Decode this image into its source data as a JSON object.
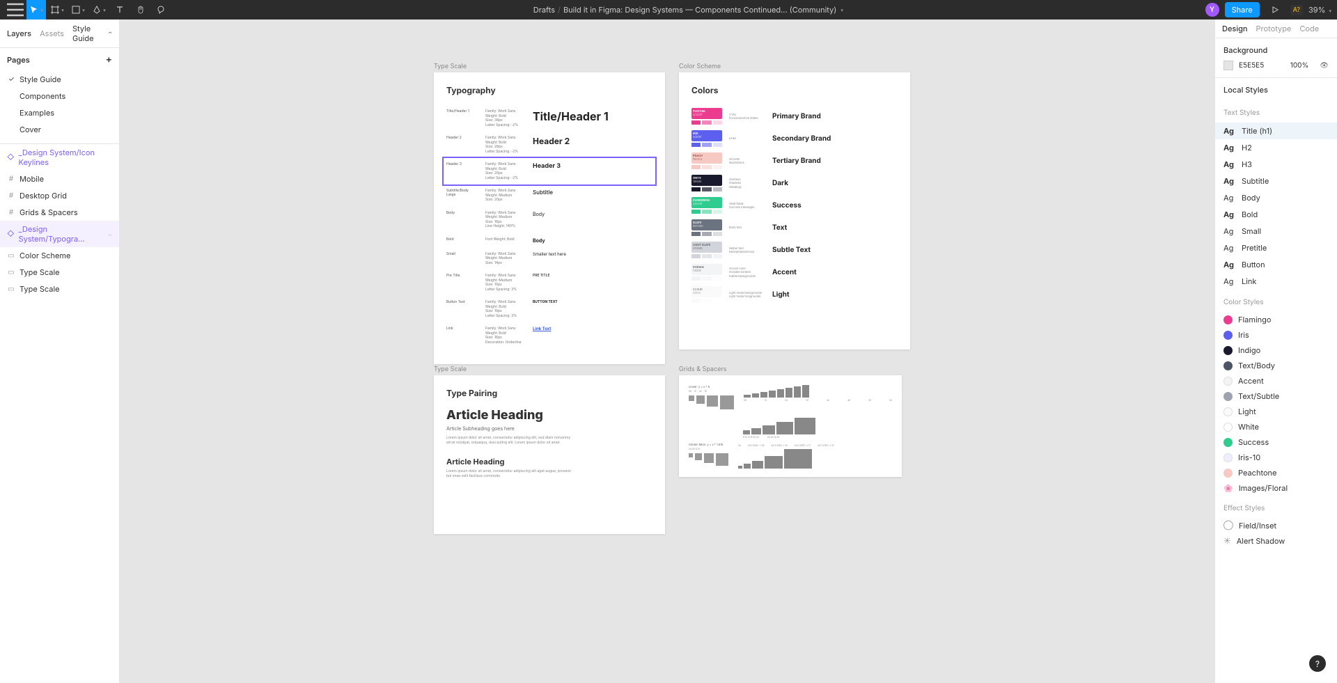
{
  "topbar": {
    "breadcrumb_root": "Drafts",
    "breadcrumb_file": "Build it in Figma: Design Systems — Components Continued... (Community)",
    "share_label": "Share",
    "a7_label": "A?",
    "zoom": "39%",
    "avatar_letter": "Y"
  },
  "left_panel": {
    "tab_layers": "Layers",
    "tab_assets": "Assets",
    "style_guide": "Style Guide",
    "pages_label": "Pages",
    "pages": [
      "Style Guide",
      "Components",
      "Examples",
      "Cover"
    ],
    "layers": [
      {
        "name": "_Design System/Icon Keylines",
        "icon": "◇",
        "system": true
      },
      {
        "name": "Mobile",
        "icon": "#"
      },
      {
        "name": "Desktop Grid",
        "icon": "#"
      },
      {
        "name": "Grids & Spacers",
        "icon": "#"
      },
      {
        "name": "_Design System/Typogra...",
        "icon": "◇",
        "system": true,
        "selected": true,
        "chevron": true
      },
      {
        "name": "Color Scheme",
        "icon": "▭"
      },
      {
        "name": "Type Scale",
        "icon": "▭"
      },
      {
        "name": "Type Scale",
        "icon": "▭"
      }
    ]
  },
  "canvas": {
    "artboards": {
      "typo": {
        "label": "Type Scale",
        "title": "Typography"
      },
      "colors": {
        "label": "Color Scheme",
        "title": "Colors"
      },
      "pair": {
        "label": "Type Scale",
        "title": "Type Pairing"
      },
      "grid": {
        "label": "Grids & Spacers"
      }
    },
    "typo_rows": [
      {
        "c1": "Title/Header 1",
        "c2": "Family: Work Sans\nWeight: Bold\nSize: 36px\nLetter Spacing: -2%",
        "c3": "Title/Header 1",
        "size": "16px"
      },
      {
        "c1": "Header 2",
        "c2": "Family: Work Sans\nWeight: Bold\nSize: 28px\nLetter Spacing: -2%",
        "c3": "Header 2",
        "size": "12px"
      },
      {
        "c1": "Header 3",
        "c2": "Family: Work Sans\nWeight: Bold\nSize: 20px\nLetter Spacing: -2%",
        "c3": "Header 3",
        "size": "9px",
        "selected": true
      },
      {
        "c1": "Subtitle/Body Large",
        "c2": "Family: Work Sans\nWeight: Medium\nSize: 20px",
        "c3": "Subtitle",
        "size": "8px",
        "weight": "500"
      },
      {
        "c1": "Body",
        "c2": "Family: Work Sans\nWeight: Medium\nSize: 16px\nLine Height: 140%",
        "c3": "Body",
        "size": "7px",
        "weight": "400"
      },
      {
        "c1": "Bold",
        "c2": "Font Weight: Bold",
        "c3": "Body",
        "size": "7px"
      },
      {
        "c1": "Small",
        "c2": "Family: Work Sans\nWeight: Medium\nSize: 14px",
        "c3": "Smaller text here",
        "size": "6px",
        "weight": "400"
      },
      {
        "c1": "Pre Title",
        "c2": "Family: Work Sans\nWeight: Medium\nSize: 10px\nLetter Spacing: 3%",
        "c3": "PRE TITLE",
        "size": "5px",
        "weight": "500"
      },
      {
        "c1": "Button Text",
        "c2": "Family: Work Sans\nWeight: Bold\nSize: 10px\nLetter Spacing: 3%",
        "c3": "BUTTON TEXT",
        "size": "5px"
      },
      {
        "c1": "Link",
        "c2": "Family: Work Sans\nWeight: Bold\nSize: 16px\nDecoration: Underline",
        "c3": "Link Text",
        "size": "6px",
        "color": "#3b5bdb",
        "underline": true
      }
    ],
    "color_rows": [
      {
        "name": "FUSCHIA",
        "hex": "#ec3c8f",
        "meta": "CTAs\nFocuses/Active states",
        "label": "Primary Brand",
        "text": "#fff",
        "tints": [
          "#ec3c8f",
          "#f285bb",
          "#fbd7e8"
        ]
      },
      {
        "name": "IRIS",
        "hex": "#5d5fef",
        "meta": "Links",
        "label": "Secondary Brand",
        "text": "#fff",
        "tints": [
          "#5d5fef",
          "#9fa0f6",
          "#dedffd"
        ]
      },
      {
        "name": "PEACH",
        "hex": "#f6c9c2",
        "meta": "Accents\nIllustrations",
        "label": "Tertiary Brand",
        "text": "#8b4a3f",
        "tints": [
          "#f6c9c2",
          "#fae0dc",
          "#fdf2f0"
        ]
      },
      {
        "name": "ONYX",
        "hex": "#1a1a2e",
        "meta": "Overlays\nShadows\nHeadings",
        "label": "Dark",
        "text": "#fff",
        "tints": [
          "#1a1a2e",
          "#555566",
          "#bbbbc4"
        ]
      },
      {
        "name": "EVERGREEN",
        "hex": "#2ecc8f",
        "meta": "Valid fields\nSuccess messages",
        "label": "Success",
        "text": "#fff",
        "tints": [
          "#2ecc8f",
          "#88e3bf",
          "#d7f5e9"
        ]
      },
      {
        "name": "SLATE",
        "hex": "#6b7280",
        "meta": "Body text",
        "label": "Text",
        "text": "#fff",
        "tints": [
          "#6b7280",
          "#a5aab3",
          "#dcdee2"
        ]
      },
      {
        "name": "LIGHT SLATE",
        "hex": "#d1d5db",
        "meta": "Helper text\nDeemphasized text",
        "label": "Subtle Text",
        "text": "#555",
        "tints": [
          "#d1d5db",
          "#e3e5e9",
          "#f2f3f5"
        ]
      },
      {
        "name": "DORIAN",
        "hex": "#f3f4f6",
        "meta": "Accent color\nInvisible borders\nSubtle backgrounds",
        "label": "Accent",
        "text": "#666",
        "tints": [
          "#f3f4f6",
          "#f8f8fa",
          "#fcfcfd"
        ]
      },
      {
        "name": "CLOUD",
        "hex": "#fafafa",
        "meta": "Light mode backgrounds\nLight mode foregrounds",
        "label": "Light",
        "text": "#888",
        "tints": [
          "#fafafa",
          "#fdfdfd",
          "#ffffff"
        ]
      }
    ],
    "pair": {
      "h1": "Article Heading",
      "sub": "Article Subheading goes here",
      "body1": "Lorem ipsum dolor sit amet, consectetur adipiscing elit, sed diam nonummy eirrat volutpat, orquaqua, dusi euting elit. Lorem ipsum dolor sit amet.",
      "h2": "Article Heading",
      "body2": "Lorem ipsum dolor sit amet, consectetur adipiscing elit aget augue, provenir bui onse velit facilisus commodo."
    },
    "grid": {
      "linear_label": "Linear: y = x * 8",
      "linear_nums": [
        "08",
        "16",
        "24",
        "32",
        "40",
        "48",
        "56",
        "64"
      ],
      "golden_label": "Golden Ratio: y = x * 1.618",
      "golden_nums": [
        "04",
        "04*(1.618¹) → 06",
        "04*(1.618²) → 10",
        "04*(1.618³) → 17",
        "04*(1.618⁴) → 27"
      ],
      "side_label": "Exception: y = 4 | 8 | 12",
      "side_nums": [
        "04",
        "08",
        "12",
        "16"
      ]
    }
  },
  "right_panel": {
    "tabs": {
      "design": "Design",
      "prototype": "Prototype",
      "code": "Code"
    },
    "background_label": "Background",
    "bg_value": "E5E5E5",
    "bg_opacity": "100%",
    "local_styles": "Local Styles",
    "text_styles_label": "Text Styles",
    "text_styles": [
      {
        "ag": "Ag",
        "label": "Title (h1)",
        "bold": true,
        "selected": true
      },
      {
        "ag": "Ag",
        "label": "H2",
        "bold": true
      },
      {
        "ag": "Ag",
        "label": "H3",
        "bold": true
      },
      {
        "ag": "Ag",
        "label": "Subtitle",
        "bold": true
      },
      {
        "ag": "Ag",
        "label": "Body",
        "bold": false
      },
      {
        "ag": "Ag",
        "label": "Bold",
        "bold": true
      },
      {
        "ag": "Ag",
        "label": "Small",
        "bold": false
      },
      {
        "ag": "Ag",
        "label": "Pretitle",
        "bold": false
      },
      {
        "ag": "Ag",
        "label": "Button",
        "bold": true
      },
      {
        "ag": "Ag",
        "label": "Link",
        "bold": false
      }
    ],
    "color_styles_label": "Color Styles",
    "color_styles": [
      {
        "name": "Flamingo",
        "color": "#ec3c8f"
      },
      {
        "name": "Iris",
        "color": "#5d5fef"
      },
      {
        "name": "Indigo",
        "color": "#1a1a2e"
      },
      {
        "name": "Text/Body",
        "color": "#4b5563"
      },
      {
        "name": "Accent",
        "color": "#f3f4f6",
        "border": true
      },
      {
        "name": "Text/Subtle",
        "color": "#9ca3af"
      },
      {
        "name": "Light",
        "color": "#fafafa",
        "border": true
      },
      {
        "name": "White",
        "color": "#ffffff",
        "border": true
      },
      {
        "name": "Success",
        "color": "#2ecc8f"
      },
      {
        "name": "Iris-10",
        "color": "#eeeffe",
        "border": true
      },
      {
        "name": "Peachtone",
        "color": "#f6c9c2"
      },
      {
        "name": "Images/Floral",
        "color": "linear",
        "icon": "🌸"
      }
    ],
    "effect_styles_label": "Effect Styles",
    "effect_styles": [
      {
        "name": "Field/Inset",
        "icon": "◯"
      },
      {
        "name": "Alert Shadow",
        "icon": "☀"
      }
    ]
  },
  "help": "?"
}
